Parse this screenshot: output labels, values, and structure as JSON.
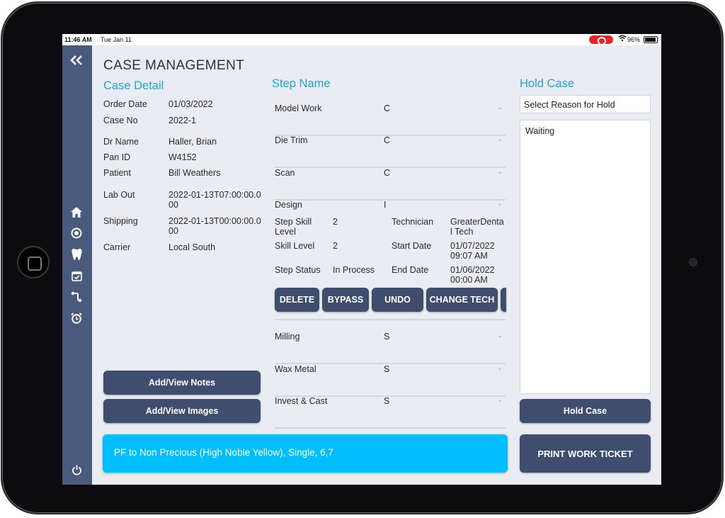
{
  "status_bar": {
    "time": "11:46 AM",
    "date": "Tue Jan 11",
    "battery": "96%"
  },
  "page_title": "CASE MANAGEMENT",
  "case_detail": {
    "heading": "Case Detail",
    "fields": [
      {
        "label": "Order Date",
        "value": "01/03/2022"
      },
      {
        "label": "Case No",
        "value": "2022-1"
      },
      {
        "label": "Dr Name",
        "value": "Haller, Brian"
      },
      {
        "label": "Pan ID",
        "value": "W4152"
      },
      {
        "label": "Patient",
        "value": "Bill Weathers"
      },
      {
        "label": "Lab Out",
        "value": "2022-01-13T07:00:00.000"
      },
      {
        "label": "Shipping",
        "value": "2022-01-13T00:00:00.000"
      },
      {
        "label": "Carrier",
        "value": "Local South"
      }
    ],
    "notes_button": "Add/View Notes",
    "images_button": "Add/View Images"
  },
  "steps": {
    "heading": "Step Name",
    "rows_top": [
      {
        "name": "Model Work",
        "code": "C"
      },
      {
        "name": "Die Trim",
        "code": "C"
      },
      {
        "name": "Scan",
        "code": "C"
      },
      {
        "name": "Design",
        "code": "I"
      }
    ],
    "design_detail": {
      "step_skill_level_label": "Step Skill Level",
      "step_skill_level_value": "2",
      "technician_label": "Technician",
      "technician_value": "GreaterDental Tech",
      "skill_level_label": "Skill Level",
      "skill_level_value": "2",
      "start_date_label": "Start Date",
      "start_date_value": "01/07/2022 09:07 AM",
      "step_status_label": "Step Status",
      "step_status_value": "In Process",
      "end_date_label": "End Date",
      "end_date_value": "01/06/2022 00:00 AM"
    },
    "actions": [
      "DELETE",
      "BYPASS",
      "UNDO",
      "CHANGE TECH"
    ],
    "rows_bottom": [
      {
        "name": "Milling",
        "code": "S"
      },
      {
        "name": "Wax Metal",
        "code": "S"
      },
      {
        "name": "Invest & Cast",
        "code": "S"
      }
    ]
  },
  "hold_case": {
    "heading": "Hold Case",
    "select_placeholder": "Select Reason for Hold",
    "reason_text": "Waiting",
    "button": "Hold Case"
  },
  "description": "PF to Non Precious (High Noble Yellow), Single, 6,7",
  "print_button": "PRINT WORK TICKET",
  "icons": [
    "collapse-chevrons-icon",
    "home-icon",
    "target-icon",
    "tooth-icon",
    "calendar-check-icon",
    "workflow-icon",
    "alarm-icon",
    "power-icon"
  ]
}
